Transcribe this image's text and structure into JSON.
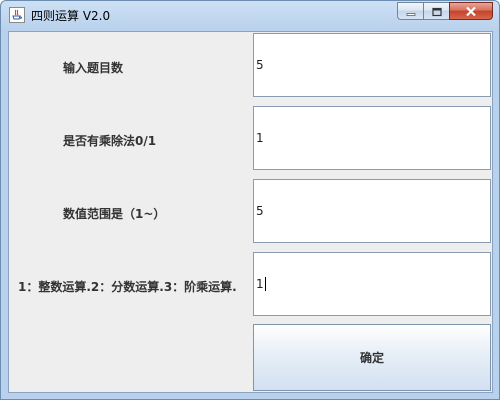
{
  "window": {
    "title": "四则运算 V2.0",
    "controls": {
      "minimize_icon": "minimize-icon",
      "maximize_icon": "maximize-icon",
      "close_icon": "close-icon"
    }
  },
  "form": {
    "rows": [
      {
        "label": "输入题目数",
        "value": "5"
      },
      {
        "label": "是否有乘除法0/1",
        "value": "1"
      },
      {
        "label": "数值范围是（1~）",
        "value": "5"
      },
      {
        "label": "1：整数运算.2：分数运算.3：阶乘运算.",
        "value": "1"
      }
    ],
    "confirm_label": "确定"
  },
  "colors": {
    "frame": "#b9d1ec",
    "panel": "#eeeeee",
    "close_button": "#c4432c"
  }
}
